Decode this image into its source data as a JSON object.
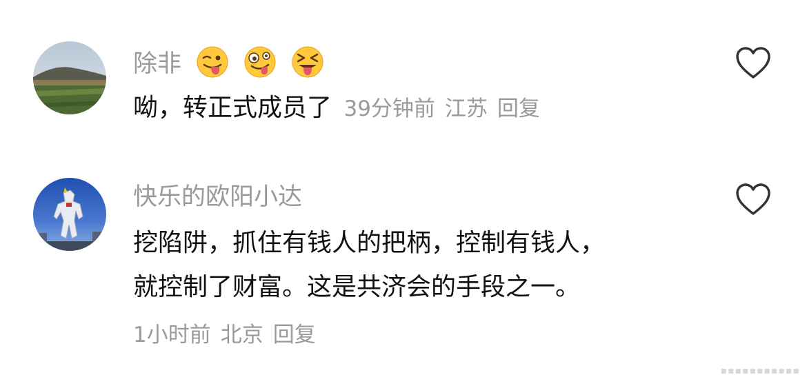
{
  "comments": [
    {
      "username": "除非",
      "avatar_icon": "landscape-hill-photo",
      "emojis": [
        "winking-tongue-emoji",
        "zany-face-emoji",
        "squinting-tongue-emoji"
      ],
      "text": "呦，转正式成员了",
      "time": "39分钟前",
      "location": "江苏",
      "reply_label": "回复"
    },
    {
      "username": "快乐的欧阳小达",
      "avatar_icon": "robot-statue-photo",
      "text_line1": "挖陷阱，抓住有钱人的把柄，控制有钱人，",
      "text_line2": "就控制了财富。这是共济会的手段之一。",
      "time": "1小时前",
      "location": "北京",
      "reply_label": "回复"
    }
  ],
  "colors": {
    "meta": "#9a9a9a",
    "text": "#111111",
    "icon_stroke": "#333333"
  }
}
